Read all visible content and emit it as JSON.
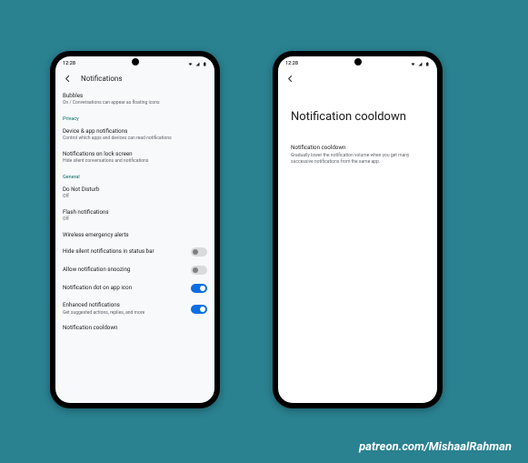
{
  "status": {
    "time": "12:28",
    "icons": "▾ ▮ ▮"
  },
  "left": {
    "header_title": "Notifications",
    "bubbles": {
      "title": "Bubbles",
      "sub": "On / Conversations can appear as floating icons"
    },
    "sections": {
      "privacy": "Privacy",
      "general": "General"
    },
    "device_app": {
      "title": "Device & app notifications",
      "sub": "Control which apps and devices can read notifications"
    },
    "lock_screen": {
      "title": "Notifications on lock screen",
      "sub": "Hide silent conversations and notifications"
    },
    "dnd": {
      "title": "Do Not Disturb",
      "sub": "Off"
    },
    "flash": {
      "title": "Flash notifications",
      "sub": "Off"
    },
    "wireless": {
      "title": "Wireless emergency alerts"
    },
    "hide_silent": {
      "title": "Hide silent notifications in status bar",
      "on": false
    },
    "snoozing": {
      "title": "Allow notification snoozing",
      "on": false
    },
    "dot": {
      "title": "Notification dot on app icon",
      "on": true
    },
    "enhanced": {
      "title": "Enhanced notifications",
      "sub": "Get suggested actions, replies, and more",
      "on": true
    },
    "cooldown": {
      "title": "Notification cooldown"
    }
  },
  "right": {
    "page_title": "Notification cooldown",
    "row": {
      "title": "Notification cooldown",
      "sub": "Gradually lower the notification volume when you get many successive notifications from the same app."
    }
  },
  "credit": "patreon.com/MishaalRahman"
}
